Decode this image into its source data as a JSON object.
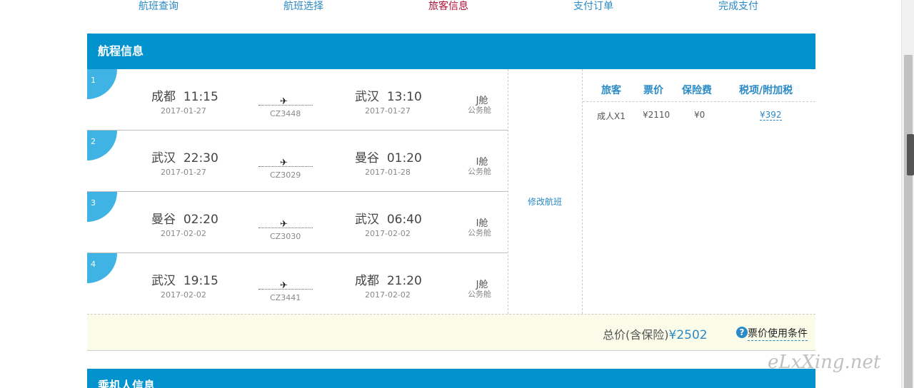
{
  "steps": [
    {
      "label": "航班查询",
      "active": false
    },
    {
      "label": "航班选择",
      "active": false
    },
    {
      "label": "旅客信息",
      "active": true
    },
    {
      "label": "支付订单",
      "active": false
    },
    {
      "label": "完成支付",
      "active": false
    }
  ],
  "itinerary": {
    "title": "航程信息",
    "modify_label": "修改航班",
    "flights": [
      {
        "seq": "1",
        "dep_city": "成都",
        "dep_time": "11:15",
        "dep_date": "2017-01-27",
        "arr_city": "武汉",
        "arr_time": "13:10",
        "arr_date": "2017-01-27",
        "flight_no": "CZ3448",
        "cabin_code": "J舱",
        "cabin_name": "公务舱"
      },
      {
        "seq": "2",
        "dep_city": "武汉",
        "dep_time": "22:30",
        "dep_date": "2017-01-27",
        "arr_city": "曼谷",
        "arr_time": "01:20",
        "arr_date": "2017-01-28",
        "flight_no": "CZ3029",
        "cabin_code": "I舱",
        "cabin_name": "公务舱"
      },
      {
        "seq": "3",
        "dep_city": "曼谷",
        "dep_time": "02:20",
        "dep_date": "2017-02-02",
        "arr_city": "武汉",
        "arr_time": "06:40",
        "arr_date": "2017-02-02",
        "flight_no": "CZ3030",
        "cabin_code": "I舱",
        "cabin_name": "公务舱"
      },
      {
        "seq": "4",
        "dep_city": "武汉",
        "dep_time": "19:15",
        "dep_date": "2017-02-02",
        "arr_city": "成都",
        "arr_time": "21:20",
        "arr_date": "2017-02-02",
        "flight_no": "CZ3441",
        "cabin_code": "J舱",
        "cabin_name": "公务舱"
      }
    ],
    "price_table": {
      "headers": [
        "旅客",
        "票价",
        "保险费",
        "税项/附加税"
      ],
      "row": [
        "成人X1",
        "¥2110",
        "¥0",
        "¥392"
      ]
    },
    "total": {
      "label": "总价(含保险)",
      "value": "¥2502",
      "rules_label": "票价使用条件",
      "help_glyph": "?"
    }
  },
  "passenger_section_title": "乘机人信息",
  "watermark": "eLxXing.net",
  "colors": {
    "accent": "#0293cf",
    "active_step": "#b0143a",
    "link": "#2a8ac6"
  }
}
